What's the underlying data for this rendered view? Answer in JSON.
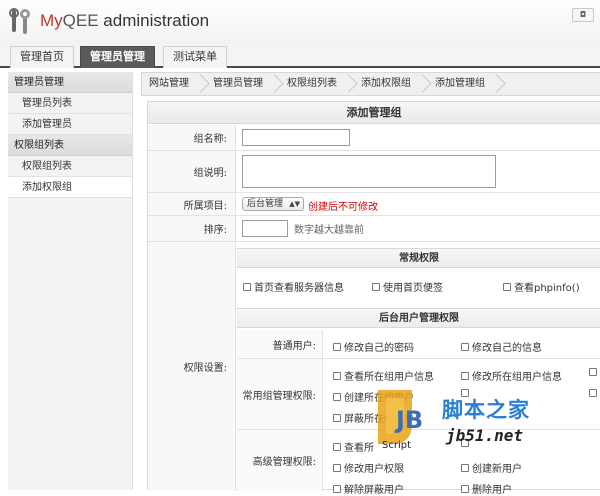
{
  "header": {
    "brand_my": "My",
    "brand_qee": "QEE",
    "brand_rest": " administration",
    "top_button": "◘"
  },
  "nav": {
    "tabs": [
      {
        "label": "管理首页",
        "active": false
      },
      {
        "label": "管理员管理",
        "active": true
      },
      {
        "label": "测试菜单",
        "active": false
      }
    ]
  },
  "sidebar": {
    "groups": [
      {
        "title": "管理员管理",
        "items": [
          {
            "label": "管理员列表"
          },
          {
            "label": "添加管理员"
          }
        ]
      },
      {
        "title": "权限组列表",
        "items": [
          {
            "label": "权限组列表"
          },
          {
            "label": "添加权限组"
          }
        ]
      }
    ]
  },
  "breadcrumb": [
    "网站管理",
    "管理员管理",
    "权限组列表",
    "添加权限组",
    "添加管理组"
  ],
  "form": {
    "title": "添加管理组",
    "name_label": "组名称:",
    "name_value": "",
    "desc_label": "组说明:",
    "desc_value": "",
    "project_label": "所属项目:",
    "project_value": "后台管理",
    "project_note": "创建后不可修改",
    "sort_label": "排序:",
    "sort_value": "",
    "sort_note": "数字越大越靠前",
    "perm_label": "权限设置:",
    "common": {
      "title": "常规权限",
      "items": [
        "首页查看服务器信息",
        "使用首页便签",
        "查看phpinfo()"
      ]
    },
    "admin": {
      "title": "后台用户管理权限",
      "normal_label": "普通用户:",
      "normal_items": [
        "修改自己的密码",
        "修改自己的信息"
      ],
      "group_label": "常用组管理权限:",
      "group_items": [
        "查看所在组用户信息",
        "修改所在组用户信息",
        "创建所在组用户",
        "",
        "屏蔽所在组用户",
        ""
      ],
      "adv_label": "高级管理权限:",
      "adv_items": [
        "查看所",
        "",
        "修改用户权限",
        "创建新用户",
        "解除屏蔽用户",
        "删除用户"
      ]
    }
  },
  "watermark": {
    "badge_letters": "JB",
    "badge_word": "Script",
    "site_cn": "脚本之家",
    "site_url": "jb51.net",
    "accent": "#2a7fd4"
  },
  "colors": {
    "active_tab": "#5a5a5a",
    "required_note": "#d40000"
  }
}
